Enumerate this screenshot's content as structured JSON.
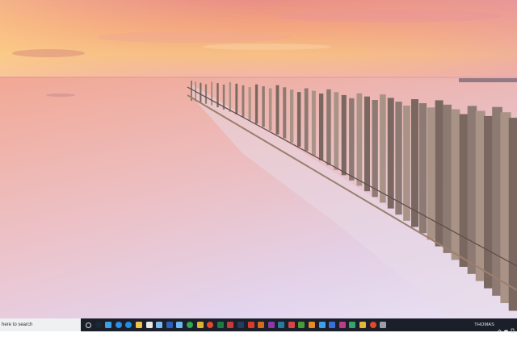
{
  "taskbar": {
    "search_placeholder": "here to search",
    "user_name": "THOMAS",
    "pinned_icons": [
      {
        "name": "task-view-icon",
        "color": "#dddddd",
        "style": "ring"
      },
      {
        "name": "steam-icon",
        "color": "#1b2838",
        "style": "round"
      },
      {
        "name": "vpn-icon",
        "color": "#3ba0e6",
        "style": "square"
      },
      {
        "name": "edge-icon",
        "color": "#2f8de4",
        "style": "round"
      },
      {
        "name": "internet-explorer-icon",
        "color": "#1f8fe0",
        "style": "round"
      },
      {
        "name": "file-explorer-icon",
        "color": "#f2c14b",
        "style": "square"
      },
      {
        "name": "store-icon",
        "color": "#e8e8e8",
        "style": "square"
      },
      {
        "name": "photos-icon",
        "color": "#7db8ee",
        "style": "square"
      },
      {
        "name": "word-icon",
        "color": "#2b5fb8",
        "style": "square"
      },
      {
        "name": "mail-icon",
        "color": "#6fb7f0",
        "style": "square"
      },
      {
        "name": "xbox-icon",
        "color": "#2fa84f",
        "style": "round"
      },
      {
        "name": "spreadsheet-icon",
        "color": "#e0b030",
        "style": "square"
      },
      {
        "name": "chrome-icon",
        "color": "#e4462e",
        "style": "round"
      },
      {
        "name": "excel-icon",
        "color": "#1e7a45",
        "style": "square"
      },
      {
        "name": "game-icon",
        "color": "#c83a3a",
        "style": "square"
      },
      {
        "name": "app-icon-dark",
        "color": "#263c5c",
        "style": "square"
      },
      {
        "name": "acrobat-icon",
        "color": "#d83b2a",
        "style": "square"
      },
      {
        "name": "media-player-icon",
        "color": "#d56a1c",
        "style": "square"
      },
      {
        "name": "onenote-icon",
        "color": "#8a3aa8",
        "style": "square"
      },
      {
        "name": "app-icon-teal",
        "color": "#2a7b9b",
        "style": "square"
      },
      {
        "name": "app-icon-red",
        "color": "#d94545",
        "style": "square"
      },
      {
        "name": "app-icon-green",
        "color": "#4a9a3a",
        "style": "square"
      },
      {
        "name": "app-icon-orange",
        "color": "#e88a25",
        "style": "square"
      },
      {
        "name": "vpn-icon-2",
        "color": "#3ba0e6",
        "style": "square"
      },
      {
        "name": "app-icon-blue",
        "color": "#3a6fd8",
        "style": "square"
      },
      {
        "name": "app-icon-magenta",
        "color": "#c03a8a",
        "style": "square"
      },
      {
        "name": "app-icon-green-2",
        "color": "#37a26b",
        "style": "square"
      },
      {
        "name": "app-icon-yellow",
        "color": "#e2b637",
        "style": "square"
      },
      {
        "name": "chrome-icon-2",
        "color": "#e4462e",
        "style": "round"
      },
      {
        "name": "app-icon-gray",
        "color": "#9aa0a8",
        "style": "square"
      }
    ],
    "tray_icons": [
      "chevron-up-icon",
      "onedrive-icon",
      "battery-icon"
    ]
  }
}
